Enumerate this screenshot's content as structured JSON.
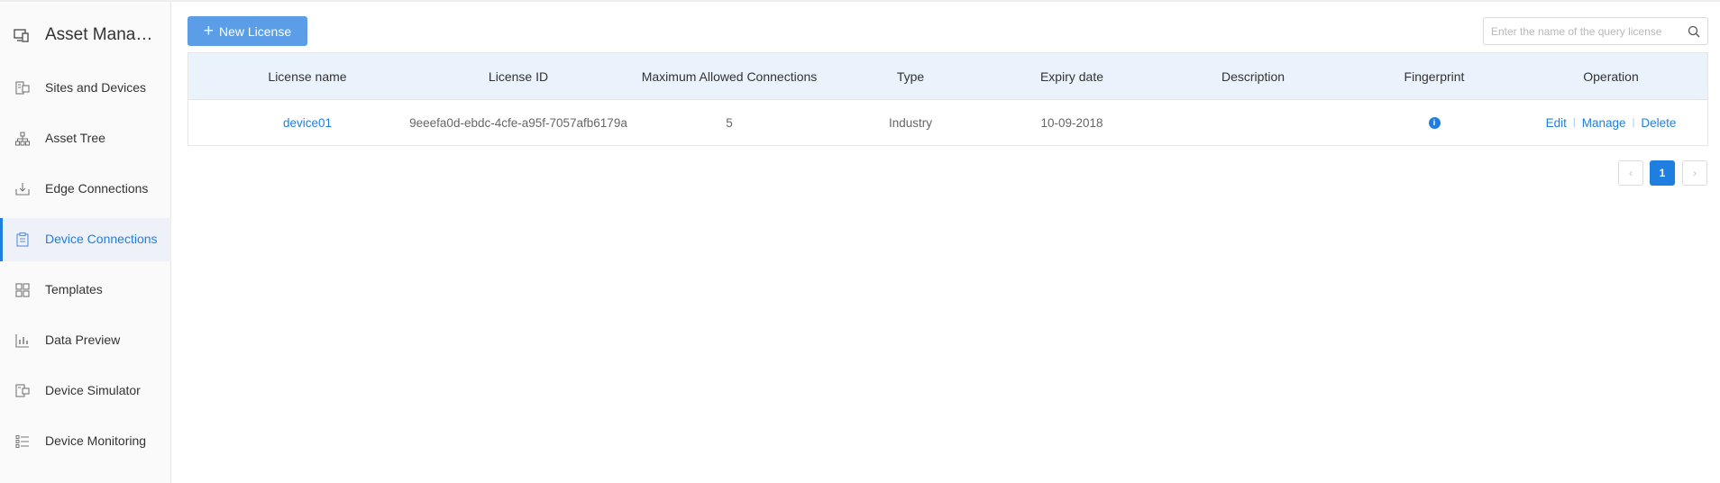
{
  "sidebar": {
    "title": "Asset Management",
    "items": [
      {
        "label": "Sites and Devices",
        "icon": "sites-devices-icon"
      },
      {
        "label": "Asset Tree",
        "icon": "asset-tree-icon"
      },
      {
        "label": "Edge Connections",
        "icon": "edge-connections-icon"
      },
      {
        "label": "Device Connections",
        "icon": "device-connections-icon",
        "active": true
      },
      {
        "label": "Templates",
        "icon": "templates-icon"
      },
      {
        "label": "Data Preview",
        "icon": "data-preview-icon"
      },
      {
        "label": "Device Simulator",
        "icon": "device-simulator-icon"
      },
      {
        "label": "Device Monitoring",
        "icon": "device-monitoring-icon"
      }
    ]
  },
  "toolbar": {
    "new_license_label": "New License"
  },
  "search": {
    "placeholder": "Enter the name of the query license",
    "value": ""
  },
  "table": {
    "columns": [
      "License name",
      "License ID",
      "Maximum Allowed Connections",
      "Type",
      "Expiry date",
      "Description",
      "Fingerprint",
      "Operation"
    ],
    "rows": [
      {
        "license_name": "device01",
        "license_id": "9eeefa0d-ebdc-4cfe-a95f-7057afb6179a",
        "max_connections": "5",
        "type": "Industry",
        "expiry_date": "10-09-2018",
        "description": "",
        "fingerprint_icon": "info-icon",
        "operations": {
          "edit": "Edit",
          "manage": "Manage",
          "delete": "Delete"
        }
      }
    ]
  },
  "pagination": {
    "prev": "‹",
    "current": "1",
    "next": "›"
  },
  "colors": {
    "accent": "#1f7fe0",
    "button": "#5b9de6",
    "header_bg": "#eaf2fb",
    "active_item_bg": "#eef1f8"
  }
}
